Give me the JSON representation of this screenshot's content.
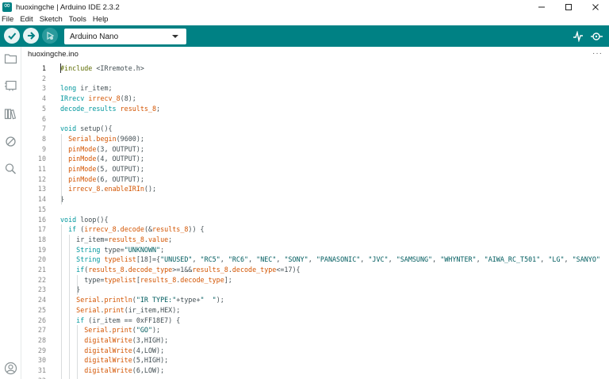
{
  "window": {
    "title": "huoxingche | Arduino IDE 2.3.2"
  },
  "menu": [
    "File",
    "Edit",
    "Sketch",
    "Tools",
    "Help"
  ],
  "toolbar": {
    "board": "Arduino Nano",
    "verify_icon": "check-icon",
    "upload_icon": "arrow-right-icon",
    "debug_icon": "debug-icon",
    "accent": "#008184"
  },
  "tabs": [
    {
      "label": "huoxingche.ino",
      "active": true
    }
  ],
  "tab_more": "···",
  "editor": {
    "current_line": 1,
    "lines": [
      {
        "n": "1",
        "t": "#include <IRremote.h>"
      },
      {
        "n": "2",
        "t": ""
      },
      {
        "n": "3",
        "t": "long ir_item;"
      },
      {
        "n": "4",
        "t": "IRrecv irrecv_8(8);"
      },
      {
        "n": "5",
        "t": "decode_results results_8;"
      },
      {
        "n": "6",
        "t": ""
      },
      {
        "n": "7",
        "t": "void setup(){"
      },
      {
        "n": "8",
        "t": "  Serial.begin(9600);"
      },
      {
        "n": "9",
        "t": "  pinMode(3, OUTPUT);"
      },
      {
        "n": "10",
        "t": "  pinMode(4, OUTPUT);"
      },
      {
        "n": "11",
        "t": "  pinMode(5, OUTPUT);"
      },
      {
        "n": "12",
        "t": "  pinMode(6, OUTPUT);"
      },
      {
        "n": "13",
        "t": "  irrecv_8.enableIRIn();"
      },
      {
        "n": "14",
        "t": "}"
      },
      {
        "n": "15",
        "t": ""
      },
      {
        "n": "16",
        "t": "void loop(){"
      },
      {
        "n": "17",
        "t": "  if (irrecv_8.decode(&results_8)) {"
      },
      {
        "n": "18",
        "t": "    ir_item=results_8.value;"
      },
      {
        "n": "19",
        "t": "    String type=\"UNKNOWN\";"
      },
      {
        "n": "20",
        "t": "    String typelist[18]={\"UNUSED\", \"RC5\", \"RC6\", \"NEC\", \"SONY\", \"PANASONIC\", \"JVC\", \"SAMSUNG\", \"WHYNTER\", \"AIWA_RC_T501\", \"LG\", \"SANYO\""
      },
      {
        "n": "21",
        "t": "    if(results_8.decode_type>=1&&results_8.decode_type<=17){"
      },
      {
        "n": "22",
        "t": "      type=typelist[results_8.decode_type];"
      },
      {
        "n": "23",
        "t": "    }"
      },
      {
        "n": "24",
        "t": "    Serial.println(\"IR TYPE:\"+type+\"  \");"
      },
      {
        "n": "25",
        "t": "    Serial.print(ir_item,HEX);"
      },
      {
        "n": "26",
        "t": "    if (ir_item == 0xFF18E7) {"
      },
      {
        "n": "27",
        "t": "      Serial.print(\"GO\");"
      },
      {
        "n": "28",
        "t": "      digitalWrite(3,HIGH);"
      },
      {
        "n": "29",
        "t": "      digitalWrite(4,LOW);"
      },
      {
        "n": "30",
        "t": "      digitalWrite(5,HIGH);"
      },
      {
        "n": "31",
        "t": "      digitalWrite(6,LOW);"
      },
      {
        "n": "32",
        "t": ""
      }
    ]
  },
  "sidebar": {
    "items": [
      {
        "name": "sketchbook-icon"
      },
      {
        "name": "boards-manager-icon"
      },
      {
        "name": "library-manager-icon"
      },
      {
        "name": "debug-icon"
      },
      {
        "name": "search-icon"
      },
      {
        "name": "account-icon"
      }
    ]
  },
  "colors": {
    "keyword": "#00979d",
    "function": "#d35400",
    "string": "#005c5f",
    "preprocessor": "#5e6d03"
  }
}
